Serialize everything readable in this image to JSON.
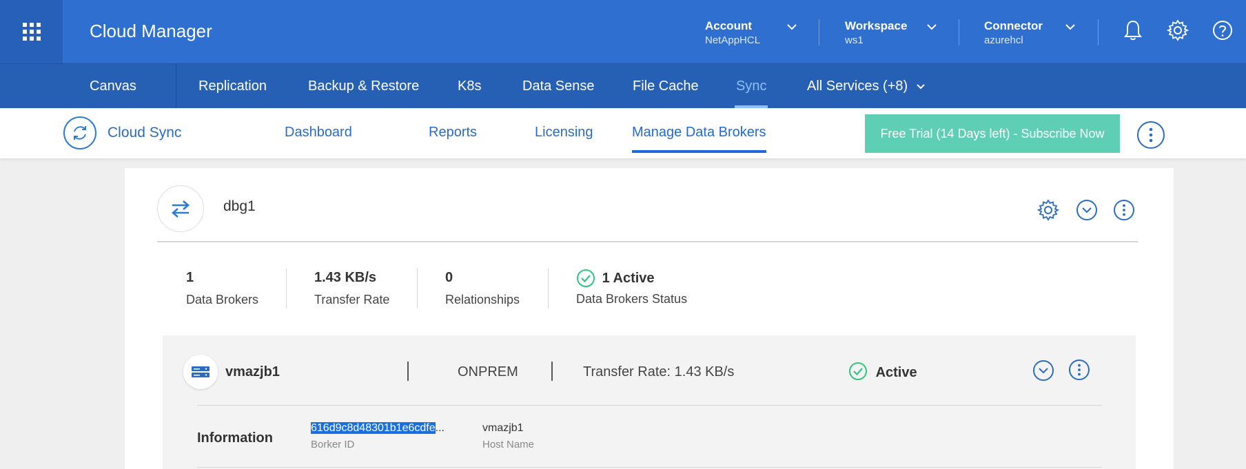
{
  "header": {
    "app_title": "Cloud Manager",
    "account": {
      "label": "Account",
      "value": "NetAppHCL"
    },
    "workspace": {
      "label": "Workspace",
      "value": "ws1"
    },
    "connector": {
      "label": "Connector",
      "value": "azurehcl"
    },
    "icons": [
      "apps-grid-icon",
      "bell-icon",
      "gear-icon",
      "help-icon"
    ]
  },
  "services_nav": {
    "items": [
      "Canvas",
      "Replication",
      "Backup & Restore",
      "K8s",
      "Data Sense",
      "File Cache",
      "Sync",
      "All Services (+8)"
    ],
    "active": "Sync"
  },
  "sync_nav": {
    "title": "Cloud Sync",
    "tabs": [
      "Dashboard",
      "Reports",
      "Licensing",
      "Manage Data Brokers"
    ],
    "active_tab": "Manage Data Brokers",
    "trial_button": "Free Trial (14 Days left) - Subscribe Now"
  },
  "group": {
    "name": "dbg1",
    "stats": {
      "brokers_count": "1",
      "brokers_label": "Data Brokers",
      "rate_value": "1.43 KB/s",
      "rate_label": "Transfer Rate",
      "relationships_count": "0",
      "relationships_label": "Relationships",
      "status_value": "1 Active",
      "status_label": "Data Brokers Status"
    },
    "broker": {
      "name": "vmazjb1",
      "type": "ONPREM",
      "transfer_rate": "Transfer Rate: 1.43 KB/s",
      "status": "Active",
      "info_label": "Information",
      "broker_id": "616d9c8d48301b1e6cdfe",
      "broker_id_ellipsis": "...",
      "broker_id_label": "Borker ID",
      "host_name": "vmazjb1",
      "host_name_label": "Host Name"
    }
  },
  "colors": {
    "header_bg": "#2f6fcf",
    "nav_bg": "#2660b4",
    "accent": "#2b6bc4",
    "trial_button": "#5ecfb4",
    "success": "#2ec77f"
  }
}
